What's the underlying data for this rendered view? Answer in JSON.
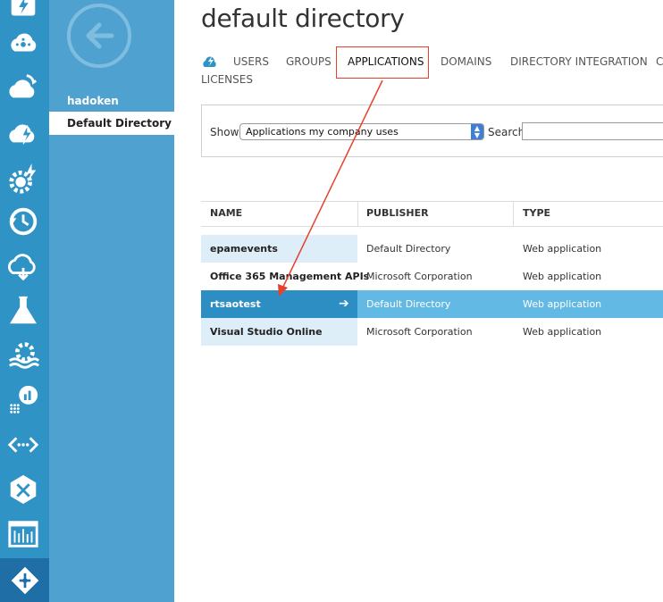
{
  "rail": {
    "icons": [
      "lightning-tile-icon",
      "cloud-network-icon",
      "cloud-upload-icon",
      "cloud-lightning-icon",
      "gear-lightning-icon",
      "clock-refresh-icon",
      "cloud-sync-icon",
      "flask-icon",
      "gear-waves-icon",
      "chart-dots-icon",
      "code-brackets-icon",
      "arrows-cross-icon",
      "dashboard-panel-icon",
      "diamond-arrows-icon"
    ]
  },
  "directory_panel": {
    "items": [
      {
        "label": "hadoken"
      },
      {
        "label": "Default Directory"
      }
    ]
  },
  "page": {
    "title": "default directory"
  },
  "tabs": {
    "users": "USERS",
    "groups": "GROUPS",
    "applications": "APPLICATIONS",
    "domains": "DOMAINS",
    "directory_integration": "DIRECTORY INTEGRATION",
    "more": "C",
    "licenses": "LICENSES"
  },
  "filter": {
    "show_label": "Show",
    "show_value": "Applications my company uses",
    "search_label": "Search",
    "search_value": ""
  },
  "table": {
    "headers": {
      "name": "NAME",
      "publisher": "PUBLISHER",
      "type": "TYPE"
    },
    "rows": [
      {
        "name": "epamevents",
        "publisher": "Default Directory",
        "type": "Web application"
      },
      {
        "name": "Office 365 Management APIs",
        "publisher": "Microsoft Corporation",
        "type": "Web application"
      },
      {
        "name": "rtsaotest",
        "publisher": "Default Directory",
        "type": "Web application"
      },
      {
        "name": "Visual Studio Online",
        "publisher": "Microsoft Corporation",
        "type": "Web application"
      }
    ],
    "selected_row_arrow": "➔"
  },
  "colors": {
    "rail": "#2f93c6",
    "panel": "#4fa2cf",
    "selected_row": "#62b9e4",
    "annotation": "#e8402a"
  }
}
